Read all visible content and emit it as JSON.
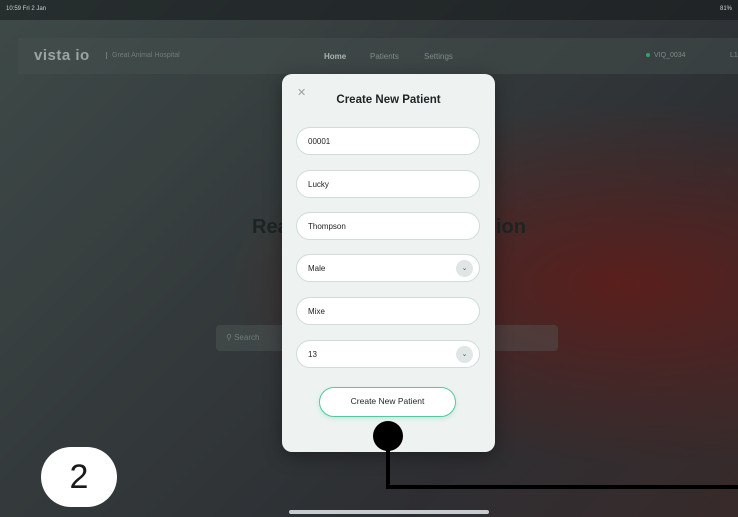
{
  "status_bar": {
    "time": "10:59  Fri 2 Jan",
    "system": "81%"
  },
  "app": {
    "logo": "vista io",
    "hospital": "Great Animal Hospital",
    "nav": [
      "Home",
      "Patients",
      "Settings"
    ],
    "device": "VIQ_0034",
    "user_abbr": "L1"
  },
  "background": {
    "heading_left": "Rea",
    "heading_right": "ion",
    "search_placeholder": "Search"
  },
  "modal": {
    "title": "Create New Patient",
    "close_icon": "close-icon",
    "fields": {
      "patient_id": "00001",
      "first_name": "Lucky",
      "last_name": "Thompson",
      "sex": "Male",
      "breed": "Mixe",
      "age": "13"
    },
    "submit_label": "Create New Patient"
  },
  "annotation": {
    "step_number": "2"
  }
}
